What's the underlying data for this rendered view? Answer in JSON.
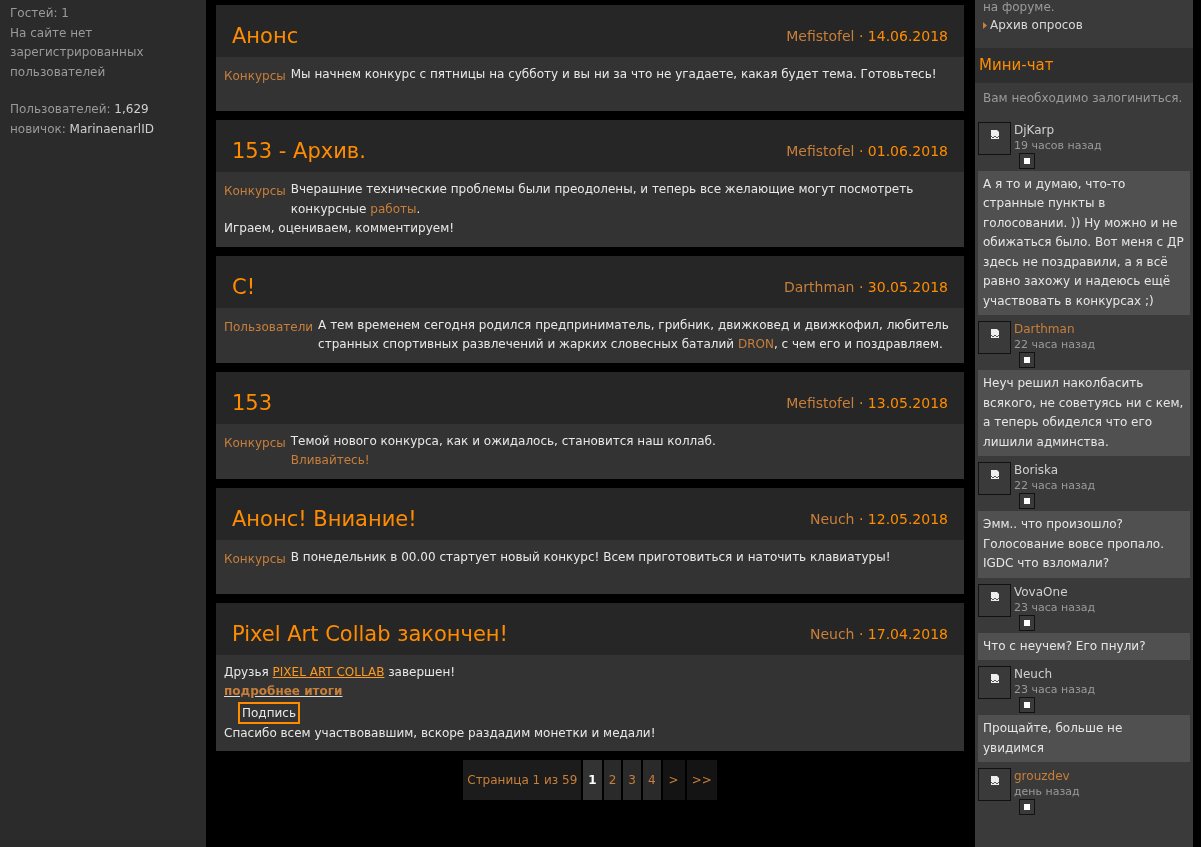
{
  "left_sidebar": {
    "lines": [
      {
        "label": "Гостей: 1"
      },
      {
        "label": "На сайте нет зарегистрированных пользователей"
      }
    ],
    "stats": [
      {
        "label": "Пользователей:",
        "value": "1,629"
      },
      {
        "label": "новичок:",
        "value": "MarinaenarlID"
      }
    ]
  },
  "posts": [
    {
      "title": "Анонс",
      "author": "Mefistofel",
      "date": "· 14.06.2018",
      "category": "Конкурсы",
      "paragraphs": [
        [
          {
            "kind": "text",
            "text": "Мы начнем конкурс с пятницы на субботу и вы ни за что не угадаете, какая будет тема. Готовьтесь!"
          }
        ]
      ]
    },
    {
      "title": "153 - Архив.",
      "author": "Mefistofel",
      "date": "· 01.06.2018",
      "category": "Конкурсы",
      "paragraphs": [
        [
          {
            "kind": "text",
            "text": "Вчерашние технические проблемы были преодолены, и теперь все желающие могут посмотреть конкурсные "
          },
          {
            "kind": "link",
            "text": "работы"
          },
          {
            "kind": "text",
            "text": "."
          }
        ],
        [
          {
            "kind": "text",
            "text": "Играем, оцениваем, комментируем!"
          }
        ]
      ]
    },
    {
      "title": "С!",
      "author": "Darthman",
      "date": "· 30.05.2018",
      "category": "Пользователи",
      "paragraphs": [
        [
          {
            "kind": "text",
            "text": "А тем временем сегодня родился предприниматель, грибник, движковед и движкофил, любитель странных спортивных развлечений и жарких словесных баталий "
          },
          {
            "kind": "link",
            "text": "DRON"
          },
          {
            "kind": "text",
            "text": ", с чем его и поздравляем."
          }
        ]
      ]
    },
    {
      "title": "153",
      "author": "Mefistofel",
      "date": "· 13.05.2018",
      "category": "Конкурсы",
      "paragraphs": [
        [
          {
            "kind": "text",
            "text": "Темой нового конкурса, как и ожидалось, становится наш коллаб."
          }
        ],
        [
          {
            "kind": "link",
            "text": "Вливайтесь!"
          }
        ]
      ]
    },
    {
      "title": "Анонс! Вниание!",
      "author": "Neuch",
      "date": "· 12.05.2018",
      "category": "Конкурсы",
      "paragraphs": [
        [
          {
            "kind": "text",
            "text": "В понедельник в 00.00 стартует новый конкурс! Всем приготовиться и наточить клавиатуры!"
          }
        ]
      ]
    },
    {
      "title": "Pixel Art Collab закончен!",
      "author": "Neuch",
      "date": "· 17.04.2018",
      "paragraphs": [
        [
          {
            "kind": "text",
            "text": "Друзья "
          },
          {
            "kind": "underlined-link",
            "text": "PIXEL ART COLLAB"
          },
          {
            "kind": "text",
            "text": " завершен!"
          }
        ],
        [
          {
            "kind": "bold-link",
            "text": "подробнее итоги"
          }
        ],
        [
          {
            "kind": "boxed",
            "text": "Подпись"
          }
        ],
        [
          {
            "kind": "text",
            "text": "Спасибо всем участвовавшим, вскоре раздадим монетки и медали!"
          }
        ]
      ]
    }
  ],
  "pagination": {
    "label": "Страница 1 из 59",
    "pages": [
      {
        "label": "1",
        "selected": true
      },
      {
        "label": "2",
        "selected": false
      },
      {
        "label": "3",
        "selected": false
      },
      {
        "label": "4",
        "selected": false
      }
    ],
    "next": ">",
    "last": ">>"
  },
  "right_sidebar": {
    "top_text": "на форуме.",
    "archive_link": "Архив опросов",
    "chat_title": "Мини-чат",
    "login_note": "Вам необходимо залогиниться.",
    "messages": [
      {
        "author": "DjKarp",
        "color": "#d0d0d0",
        "time": "19 часов назад",
        "text": "А я то и думаю, что-то странные пункты в голосовании. )) Ну можно и не обижаться было. Вот меня с ДР здесь не поздравили, а я всё равно захожу и надеюсь ещё участвовать в конкурсах ;)"
      },
      {
        "author": "Darthman",
        "color": "#c87f3a",
        "time": "22 часа назад",
        "text": "Неуч решил наколбасить всякого, не советуясь ни с кем, а теперь обиделся что его лишили админства."
      },
      {
        "author": "Boriska",
        "color": "#d0d0d0",
        "time": "22 часа назад",
        "text": "Эмм.. что произошло? Голосование вовсе пропало. IGDC что взломали?"
      },
      {
        "author": "VovaOne",
        "color": "#d0d0d0",
        "time": "23 часа назад",
        "text": "Что с неучем? Его пнули?"
      },
      {
        "author": "Neuch",
        "color": "#d0d0d0",
        "time": "23 часа назад",
        "text": "Прощайте, больше не увидимся"
      },
      {
        "author": "grouzdev",
        "color": "#c87f3a",
        "time": "день назад"
      }
    ]
  }
}
